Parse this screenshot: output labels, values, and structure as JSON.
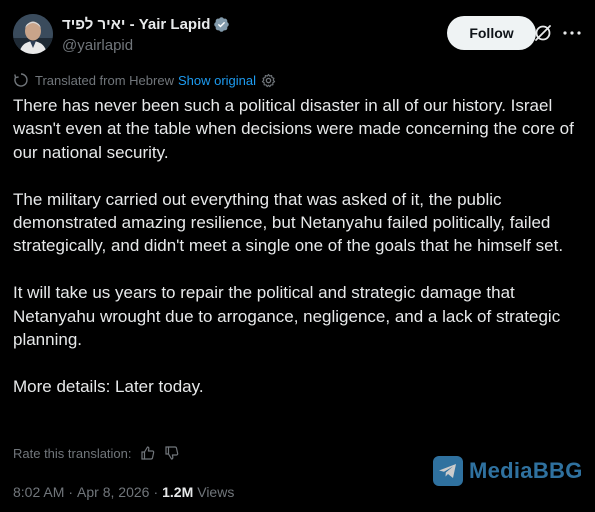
{
  "author": {
    "display_name": "יאיר לפיד - Yair Lapid",
    "handle": "@yairlapid",
    "verified": true
  },
  "actions": {
    "follow_label": "Follow"
  },
  "translation": {
    "label": "Translated from Hebrew",
    "show_original_label": "Show original"
  },
  "tweet": {
    "paragraphs": [
      "There has never been such a political disaster in all of our history. Israel wasn't even at the table when decisions were made concerning the core of our national security.",
      "The military carried out everything that was asked of it, the public demonstrated amazing resilience, but Netanyahu failed politically, failed strategically, and didn't meet a single one of the goals that he himself set.",
      "It will take us years to repair the political and strategic damage that Netanyahu wrought due to arrogance, negligence, and a lack of strategic planning.",
      "More details: Later today."
    ]
  },
  "rating": {
    "label": "Rate this translation:"
  },
  "meta": {
    "time": "8:02 AM",
    "separator": "·",
    "date": "Apr 8, 2026",
    "views_count": "1.2M",
    "views_label": "Views"
  },
  "watermark": {
    "text": "MediaBBG"
  },
  "colors": {
    "background": "#000000",
    "text": "#e7e9ea",
    "secondary": "#71767b",
    "link": "#1d9bf0",
    "verified": "#829aab",
    "follow_bg": "#eff3f4",
    "watermark": "#3b8ec7"
  },
  "icons": {
    "verified": "verified-badge-icon",
    "grok": "grok-icon",
    "more": "more-icon",
    "translate": "translate-icon",
    "settings": "gear-icon",
    "thumbs_up": "thumbs-up-icon",
    "thumbs_down": "thumbs-down-icon",
    "telegram": "telegram-icon"
  }
}
